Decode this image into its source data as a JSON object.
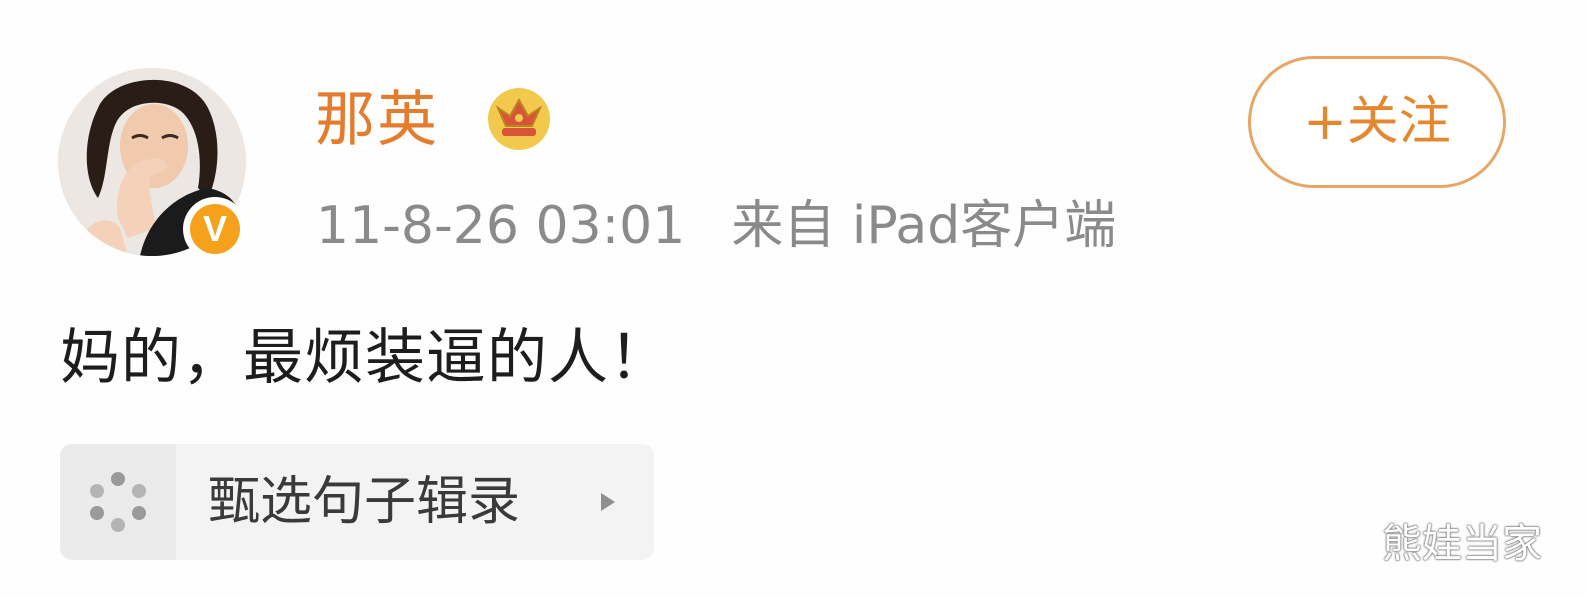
{
  "post": {
    "username": "那英",
    "timestamp": "11-8-26 03:01",
    "source": "来自 iPad客户端",
    "follow_label": "+关注",
    "content": "妈的，最烦装逼的人！",
    "verified_icon": "verified-v-badge-icon",
    "rank_icon": "crown-icon"
  },
  "attachment": {
    "label": "甄选句子辑录",
    "icon": "pinwheel-icon",
    "arrow_icon": "triangle-right-icon"
  },
  "watermark": {
    "text": "熊娃当家"
  },
  "colors": {
    "username": "#e57b2c",
    "follow_border": "#e6a664",
    "badge": "#f6a11c",
    "meta_text": "#8a8a8a",
    "body_text": "#1d1d1d"
  }
}
